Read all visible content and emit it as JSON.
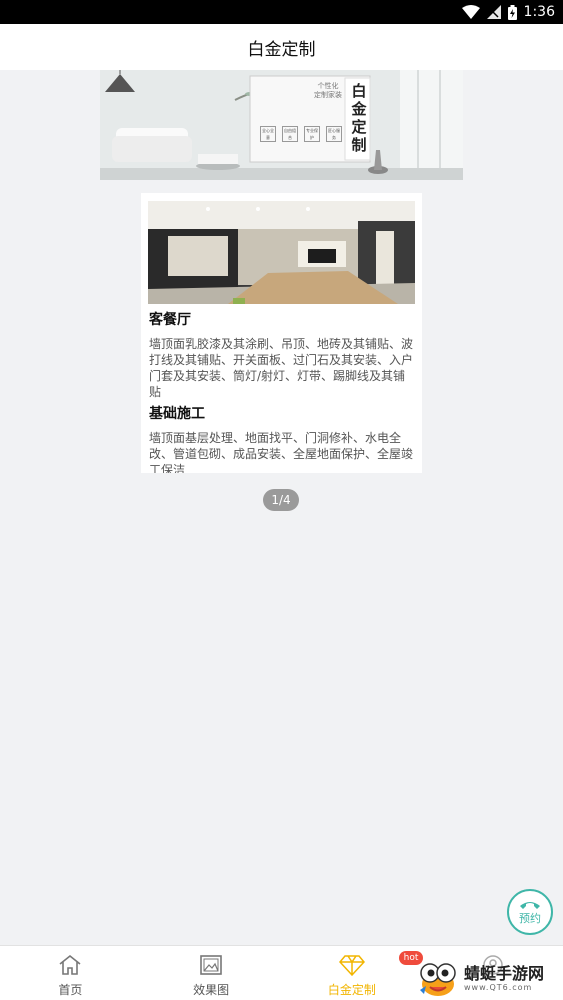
{
  "status_bar": {
    "time": "1:36",
    "icons": [
      "wifi-icon",
      "signal-icon",
      "battery-icon"
    ]
  },
  "header": {
    "title": "白金定制"
  },
  "banner": {
    "vertical_title": [
      "白",
      "金",
      "定",
      "制"
    ],
    "tagline_lines": [
      "个性化",
      "定制家装"
    ],
    "feature_tags": [
      "全心全意",
      "自由组合",
      "专业保护",
      "匠心服务"
    ]
  },
  "card": {
    "sections": [
      {
        "title": "客餐厅",
        "text": "墙顶面乳胶漆及其涂刷、吊顶、地砖及其铺贴、波打线及其铺贴、开关面板、过门石及其安装、入户门套及其安装、筒灯/射灯、灯带、踢脚线及其铺贴"
      },
      {
        "title": "基础施工",
        "text": "墙顶面基层处理、地面找平、门洞修补、水电全改、管道包砌、成品安装、全屋地面保护、全屋竣工保洁"
      }
    ]
  },
  "pager": {
    "text": "1/4"
  },
  "reserve_button": {
    "label": "预约"
  },
  "tabs": [
    {
      "label": "首页",
      "icon": "home-icon",
      "active": false
    },
    {
      "label": "效果图",
      "icon": "image-icon",
      "active": false
    },
    {
      "label": "白金定制",
      "icon": "diamond-icon",
      "active": true,
      "badge": "hot"
    },
    {
      "label": "",
      "icon": "profile-icon",
      "active": false
    }
  ],
  "watermark": {
    "title": "蜻蜓手游网",
    "url": "www.QT6.com"
  },
  "colors": {
    "accent": "#f2b500",
    "teal": "#3fb6a8",
    "hot": "#ef4b3c"
  }
}
